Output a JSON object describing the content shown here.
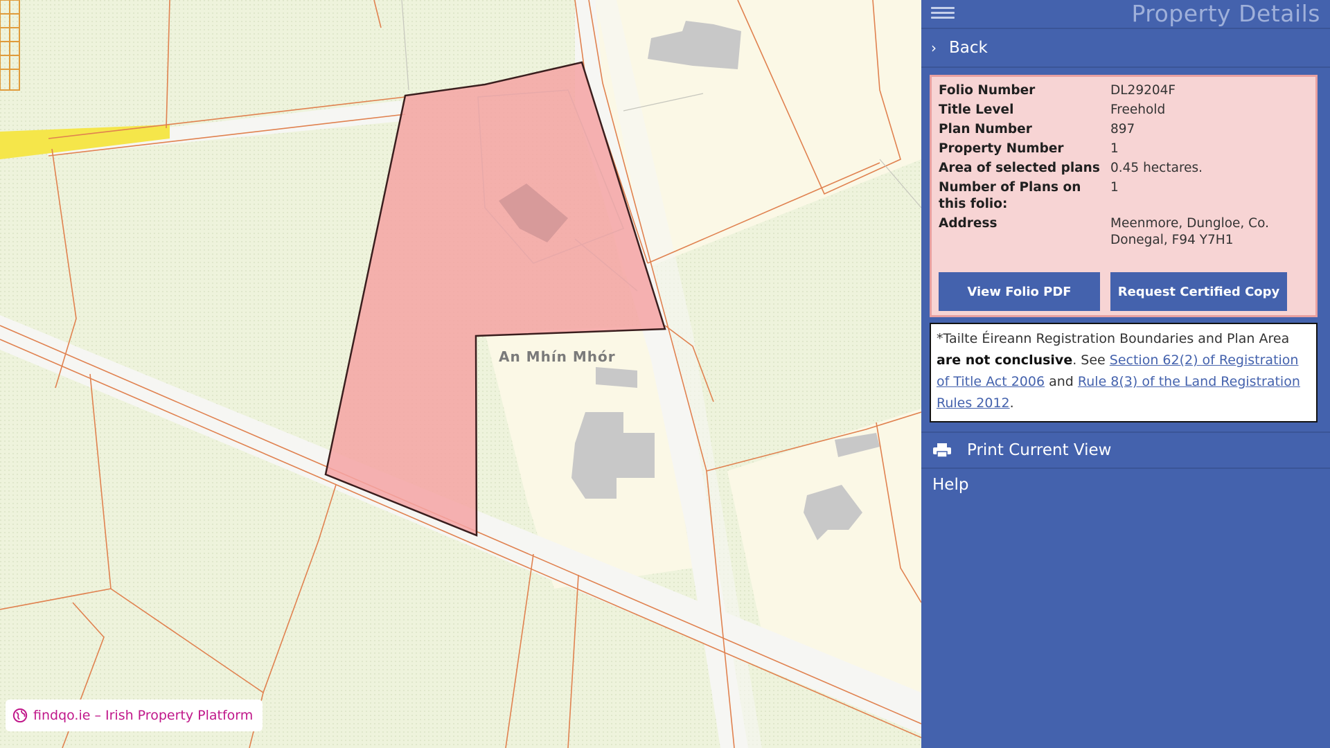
{
  "panel": {
    "title": "Property Details",
    "back_label": "Back",
    "details": [
      {
        "key": "Folio Number",
        "value": "DL29204F"
      },
      {
        "key": "Title Level",
        "value": "Freehold"
      },
      {
        "key": "Plan Number",
        "value": "897"
      },
      {
        "key": "Property Number",
        "value": "1"
      },
      {
        "key": "Area of selected plans",
        "value": "0.45 hectares."
      },
      {
        "key": "Number of Plans on this folio:",
        "value": "1"
      },
      {
        "key": "Address",
        "value": "Meenmore, Dungloe, Co. Donegal, F94 Y7H1"
      }
    ],
    "view_pdf_label": "View Folio PDF",
    "certified_copy_label": "Request Certified Copy",
    "notice": {
      "prefix": "*Tailte Éireann Registration Boundaries and Plan Area ",
      "bold": "are not conclusive",
      "mid": ". See ",
      "link1": "Section 62(2) of Registration of Title Act 2006",
      "and": " and ",
      "link2": "Rule 8(3) of the Land Registration Rules 2012",
      "suffix": "."
    },
    "print_label": "Print Current View",
    "help_label": "Help"
  },
  "map": {
    "place_label": "An Mhín Mhór",
    "watermark": "findqo.ie – Irish Property Platform",
    "parcel_fill": "#f4a3a3",
    "boundary_color": "#e0814f"
  },
  "colors": {
    "panel_bg": "#4462ad",
    "detail_bg": "#f7d4d4",
    "watermark_text": "#c0188a"
  }
}
